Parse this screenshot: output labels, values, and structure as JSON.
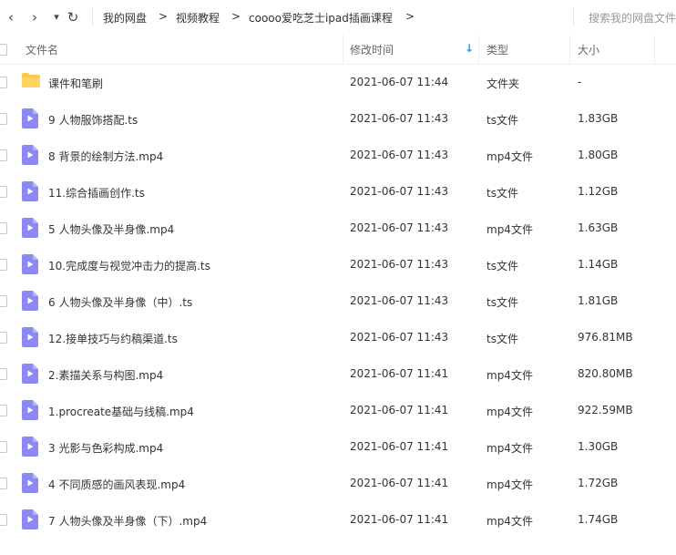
{
  "toolbar": {
    "back_icon": "chevron-left-icon",
    "forward_icon": "chevron-right-icon",
    "history_icon": "caret-down-icon",
    "refresh_icon": "refresh-icon",
    "back_glyph": "‹",
    "forward_glyph": "›",
    "dropdown_glyph": "▾",
    "refresh_glyph": "↻"
  },
  "breadcrumb": {
    "items": [
      "我的网盘",
      "视频教程",
      "coooo爱吃芝士ipad插画课程"
    ],
    "separator": ">"
  },
  "search": {
    "placeholder": "搜索我的网盘文件"
  },
  "columns": {
    "name": "文件名",
    "time": "修改时间",
    "type": "类型",
    "size": "大小",
    "sort_indicator": "↓"
  },
  "colors": {
    "accent": "#06a7ff",
    "folder": "#ffc64b",
    "video_icon": "#8c88f5"
  },
  "files": [
    {
      "name": "课件和笔刷",
      "time": "2021-06-07 11:44",
      "type": "文件夹",
      "size": "-",
      "icon": "folder-icon"
    },
    {
      "name": "9 人物服饰搭配.ts",
      "time": "2021-06-07 11:43",
      "type": "ts文件",
      "size": "1.83GB",
      "icon": "video-file-icon"
    },
    {
      "name": "8 背景的绘制方法.mp4",
      "time": "2021-06-07 11:43",
      "type": "mp4文件",
      "size": "1.80GB",
      "icon": "video-file-icon"
    },
    {
      "name": "11.综合插画创作.ts",
      "time": "2021-06-07 11:43",
      "type": "ts文件",
      "size": "1.12GB",
      "icon": "video-file-icon"
    },
    {
      "name": "5 人物头像及半身像.mp4",
      "time": "2021-06-07 11:43",
      "type": "mp4文件",
      "size": "1.63GB",
      "icon": "video-file-icon"
    },
    {
      "name": "10.完成度与视觉冲击力的提高.ts",
      "time": "2021-06-07 11:43",
      "type": "ts文件",
      "size": "1.14GB",
      "icon": "video-file-icon"
    },
    {
      "name": "6 人物头像及半身像（中）.ts",
      "time": "2021-06-07 11:43",
      "type": "ts文件",
      "size": "1.81GB",
      "icon": "video-file-icon"
    },
    {
      "name": "12.接单技巧与约稿渠道.ts",
      "time": "2021-06-07 11:43",
      "type": "ts文件",
      "size": "976.81MB",
      "icon": "video-file-icon"
    },
    {
      "name": "2.素描关系与构图.mp4",
      "time": "2021-06-07 11:41",
      "type": "mp4文件",
      "size": "820.80MB",
      "icon": "video-file-icon"
    },
    {
      "name": "1.procreate基础与线稿.mp4",
      "time": "2021-06-07 11:41",
      "type": "mp4文件",
      "size": "922.59MB",
      "icon": "video-file-icon"
    },
    {
      "name": "3 光影与色彩构成.mp4",
      "time": "2021-06-07 11:41",
      "type": "mp4文件",
      "size": "1.30GB",
      "icon": "video-file-icon"
    },
    {
      "name": "4 不同质感的画风表现.mp4",
      "time": "2021-06-07 11:41",
      "type": "mp4文件",
      "size": "1.72GB",
      "icon": "video-file-icon"
    },
    {
      "name": "7 人物头像及半身像（下）.mp4",
      "time": "2021-06-07 11:41",
      "type": "mp4文件",
      "size": "1.74GB",
      "icon": "video-file-icon"
    }
  ]
}
